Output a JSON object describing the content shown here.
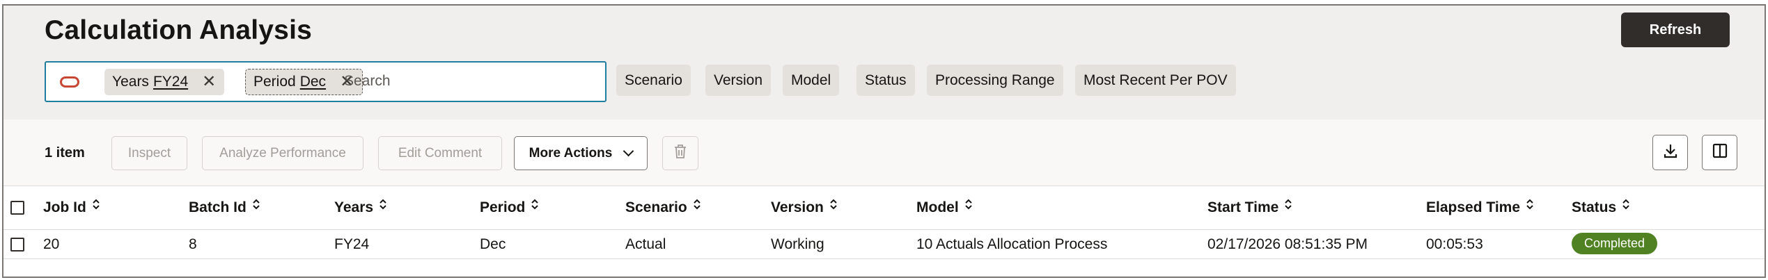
{
  "header": {
    "title": "Calculation Analysis",
    "refresh_label": "Refresh"
  },
  "search": {
    "chips": [
      {
        "label": "Years",
        "value": "FY24"
      },
      {
        "label": "Period",
        "value": "Dec"
      }
    ],
    "placeholder": "Search"
  },
  "filters": [
    "Scenario",
    "Version",
    "Model",
    "Status",
    "Processing Range",
    "Most Recent Per POV"
  ],
  "toolbar": {
    "item_count": "1 item",
    "inspect": "Inspect",
    "analyze": "Analyze Performance",
    "edit_comment": "Edit Comment",
    "more_actions": "More Actions",
    "icons": [
      "trash-icon",
      "download-icon",
      "column-panel-icon"
    ]
  },
  "table": {
    "columns": [
      "Job Id",
      "Batch Id",
      "Years",
      "Period",
      "Scenario",
      "Version",
      "Model",
      "Start Time",
      "Elapsed Time",
      "Status"
    ],
    "rows": [
      {
        "job_id": "20",
        "batch_id": "8",
        "years": "FY24",
        "period": "Dec",
        "scenario": "Actual",
        "version": "Working",
        "model": "10 Actuals Allocation Process",
        "start_time": "02/17/2026 08:51:35 PM",
        "elapsed_time": "00:05:53",
        "status": "Completed"
      }
    ]
  },
  "colors": {
    "accent_border": "#227e9e",
    "status_completed": "#508223",
    "oracle_red": "#c74634",
    "primary_button": "#312d2a"
  }
}
